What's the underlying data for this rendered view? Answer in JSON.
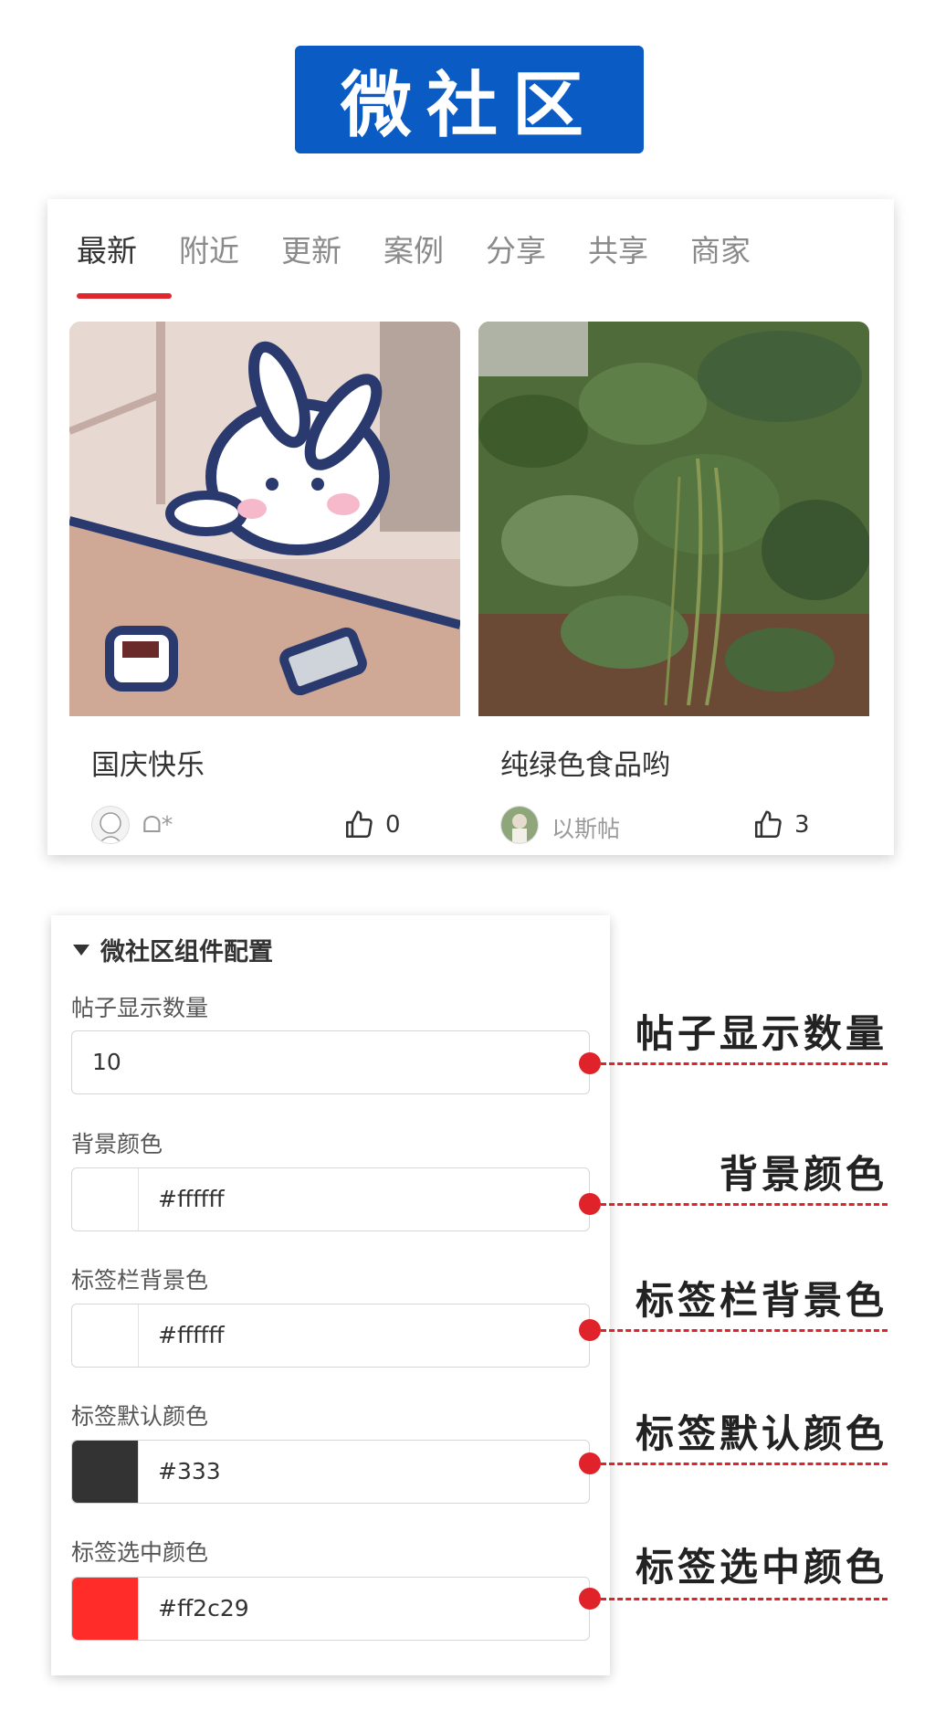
{
  "banner": {
    "title": "微社区"
  },
  "preview": {
    "tabs": [
      "最新",
      "附近",
      "更新",
      "案例",
      "分享",
      "共享",
      "商家"
    ],
    "active_tab_color": "#e0262f",
    "posts": [
      {
        "title": "国庆快乐",
        "author": "ᗝ*",
        "likes": "0",
        "image": "rabbit-illustration"
      },
      {
        "title": "纯绿色食品哟",
        "author": "以斯帖",
        "likes": "3",
        "image": "garden-plants-photo"
      }
    ]
  },
  "config": {
    "header": "微社区组件配置",
    "fields": {
      "post_count": {
        "label": "帖子显示数量",
        "value": "10"
      },
      "bg_color": {
        "label": "背景颜色",
        "value": "#ffffff",
        "swatch": "#ffffff"
      },
      "tabbar_bg_color": {
        "label": "标签栏背景色",
        "value": "#ffffff",
        "swatch": "#ffffff"
      },
      "tab_default_color": {
        "label": "标签默认颜色",
        "value": "#333",
        "swatch": "#333333"
      },
      "tab_active_color": {
        "label": "标签选中颜色",
        "value": "#ff2c29",
        "swatch": "#ff2c29"
      }
    }
  },
  "callouts": [
    "帖子显示数量",
    "背景颜色",
    "标签栏背景色",
    "标签默认颜色",
    "标签选中颜色"
  ],
  "colors": {
    "brand_blue": "#0a5bc4",
    "annotation_red": "#e0222a"
  }
}
